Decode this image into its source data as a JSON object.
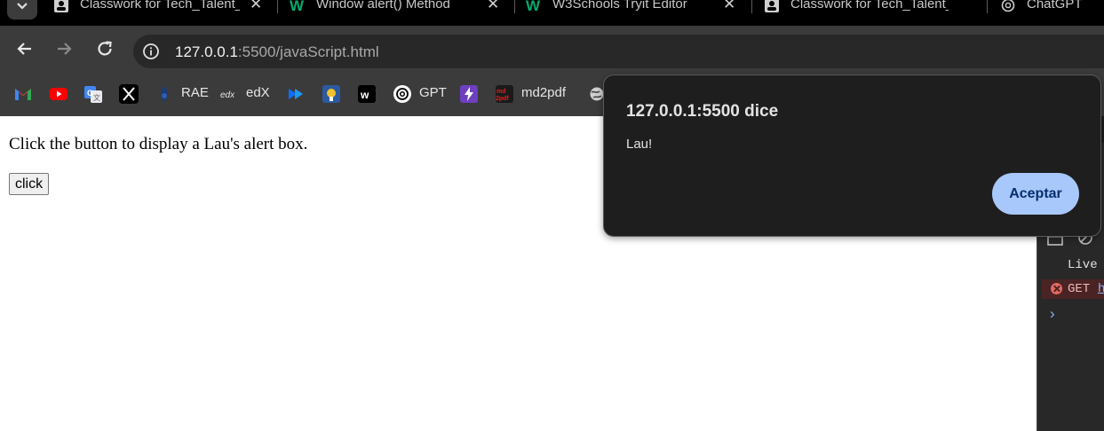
{
  "tabs": [
    {
      "title": "Classwork for Tech_Talent_",
      "icon": "classroom-icon"
    },
    {
      "title": "Window alert() Method",
      "icon": "w3schools-icon"
    },
    {
      "title": "W3Schools Tryit Editor",
      "icon": "w3schools-icon"
    },
    {
      "title": "Classwork for Tech_Talent_",
      "icon": "classroom-icon"
    },
    {
      "title": "ChatGPT",
      "icon": "openai-icon"
    }
  ],
  "toolbar": {
    "url_host": "127.0.0.1",
    "url_path": ":5500/javaScript.html"
  },
  "bookmarks": [
    {
      "label": "",
      "icon": "gmail-icon"
    },
    {
      "label": "",
      "icon": "youtube-icon"
    },
    {
      "label": "",
      "icon": "google-translate-icon"
    },
    {
      "label": "",
      "icon": "x-icon"
    },
    {
      "label": "RAE",
      "icon": "rae-icon"
    },
    {
      "label": "edX",
      "icon": "edx-icon"
    },
    {
      "label": "",
      "icon": "bookmark-icon"
    },
    {
      "label": "",
      "icon": "bookmark-icon"
    },
    {
      "label": "",
      "icon": "bookmark-icon"
    },
    {
      "label": "GPT",
      "icon": "openai-icon"
    },
    {
      "label": "",
      "icon": "bolt-icon"
    },
    {
      "label": "md2pdf",
      "icon": "md2pdf-icon"
    },
    {
      "label": "",
      "icon": "globe-icon"
    }
  ],
  "page": {
    "text": "Click the button to display a Lau's alert box.",
    "button_label": "click"
  },
  "dialog": {
    "title": "127.0.0.1:5500 dice",
    "message": "Lau!",
    "ok_label": "Aceptar"
  },
  "devtools": {
    "live_text": "Live",
    "error_method": "GET",
    "error_link": "h",
    "prompt": "›"
  },
  "colors": {
    "dialog_bg": "#1e1e1e",
    "dialog_button": "#a8c7fa",
    "toolbar_bg": "#3b3b3b",
    "error_bg": "#4a2424"
  }
}
